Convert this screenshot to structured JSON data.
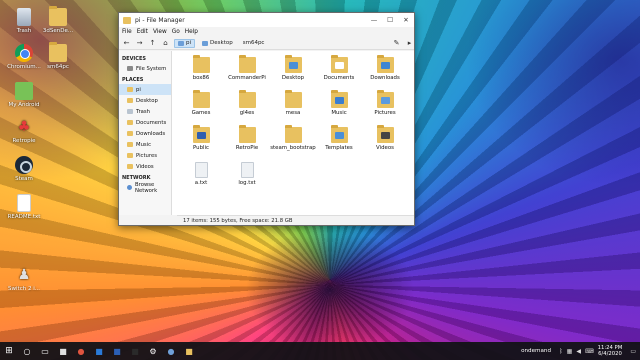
{
  "desktop": {
    "icons": [
      {
        "label": "Trash",
        "icon": "trash-icon"
      },
      {
        "label": "3dSenDe...",
        "icon": "folder-icon"
      },
      {
        "label": "Chromium...",
        "icon": "chromium-icon"
      },
      {
        "label": "sm64pc",
        "icon": "folder-icon"
      },
      {
        "label": "My Android",
        "icon": "android-icon"
      },
      {
        "label": "Retropie",
        "icon": "retropie-icon"
      },
      {
        "label": "Steam",
        "icon": "steam-icon"
      },
      {
        "label": "README.txt",
        "icon": "text-file-icon"
      },
      {
        "label": "Switch 2 i...",
        "icon": "switch-icon"
      }
    ]
  },
  "window": {
    "title": "pi - File Manager",
    "controls": {
      "minimize": "—",
      "maximize": "☐",
      "close": "✕"
    },
    "menu": [
      "File",
      "Edit",
      "View",
      "Go",
      "Help"
    ],
    "toolbar": {
      "back": "←",
      "forward": "→",
      "up": "↑",
      "home": "⌂",
      "breadcrumbs": [
        "pi",
        "Desktop",
        "sm64pc"
      ],
      "edit": "✎",
      "more": "▸"
    },
    "sidebar": {
      "devices_header": "DEVICES",
      "devices": [
        {
          "label": "File System",
          "icon": "drive-icon"
        }
      ],
      "places_header": "PLACES",
      "places": [
        {
          "label": "pi",
          "icon": "home-icon",
          "selected": true
        },
        {
          "label": "Desktop",
          "icon": "folder-icon"
        },
        {
          "label": "Trash",
          "icon": "trash-icon"
        },
        {
          "label": "Documents",
          "icon": "folder-icon"
        },
        {
          "label": "Downloads",
          "icon": "folder-icon"
        },
        {
          "label": "Music",
          "icon": "folder-icon"
        },
        {
          "label": "Pictures",
          "icon": "folder-icon"
        },
        {
          "label": "Videos",
          "icon": "folder-icon"
        }
      ],
      "network_header": "NETWORK",
      "network": [
        {
          "label": "Browse Network",
          "icon": "network-icon"
        }
      ]
    },
    "files": [
      {
        "name": "box86",
        "type": "folder",
        "emblem": ""
      },
      {
        "name": "CommanderPi",
        "type": "folder",
        "emblem": ""
      },
      {
        "name": "Desktop",
        "type": "folder",
        "emblem": "#4a8fd8"
      },
      {
        "name": "Documents",
        "type": "folder",
        "emblem": "#ffffff"
      },
      {
        "name": "Downloads",
        "type": "folder",
        "emblem": "#3f86d4"
      },
      {
        "name": "Games",
        "type": "folder",
        "emblem": ""
      },
      {
        "name": "gl4es",
        "type": "folder",
        "emblem": ""
      },
      {
        "name": "mesa",
        "type": "folder",
        "emblem": ""
      },
      {
        "name": "Music",
        "type": "folder",
        "emblem": "#3a7ed0"
      },
      {
        "name": "Pictures",
        "type": "folder",
        "emblem": "#5a9be0"
      },
      {
        "name": "Public",
        "type": "folder",
        "emblem": "#2f5fb0"
      },
      {
        "name": "RetroPie",
        "type": "folder",
        "emblem": ""
      },
      {
        "name": "steam_bootstrap",
        "type": "folder",
        "emblem": ""
      },
      {
        "name": "Templates",
        "type": "folder",
        "emblem": "#4a8fd8"
      },
      {
        "name": "Videos",
        "type": "folder",
        "emblem": "#444444"
      },
      {
        "name": "a.txt",
        "type": "file",
        "emblem": ""
      },
      {
        "name": "log.txt",
        "type": "file",
        "emblem": ""
      }
    ],
    "status": "17 items: 155 bytes, Free space: 21.8 GB"
  },
  "taskbar": {
    "apps": [
      {
        "name": "search-icon",
        "glyph": "○",
        "color": "#ffffff"
      },
      {
        "name": "taskview-icon",
        "glyph": "▭",
        "color": "#ffffff"
      },
      {
        "name": "store-icon",
        "glyph": "■",
        "color": "#e0e0e0"
      },
      {
        "name": "chrome-icon",
        "glyph": "●",
        "color": "#e0543f"
      },
      {
        "name": "mail-icon",
        "glyph": "■",
        "color": "#2a7ad8"
      },
      {
        "name": "word-icon",
        "glyph": "■",
        "color": "#2b5fb5"
      },
      {
        "name": "terminal-icon",
        "glyph": "■",
        "color": "#2a2a2a"
      },
      {
        "name": "settings-icon",
        "glyph": "⚙",
        "color": "#ffffff"
      },
      {
        "name": "globe-icon",
        "glyph": "●",
        "color": "#6fa0d8"
      },
      {
        "name": "folder-icon",
        "glyph": "■",
        "color": "#e9c15f"
      }
    ],
    "tray_text": "ondemand",
    "time": "11:24 PM",
    "date": "6/4/2020"
  }
}
